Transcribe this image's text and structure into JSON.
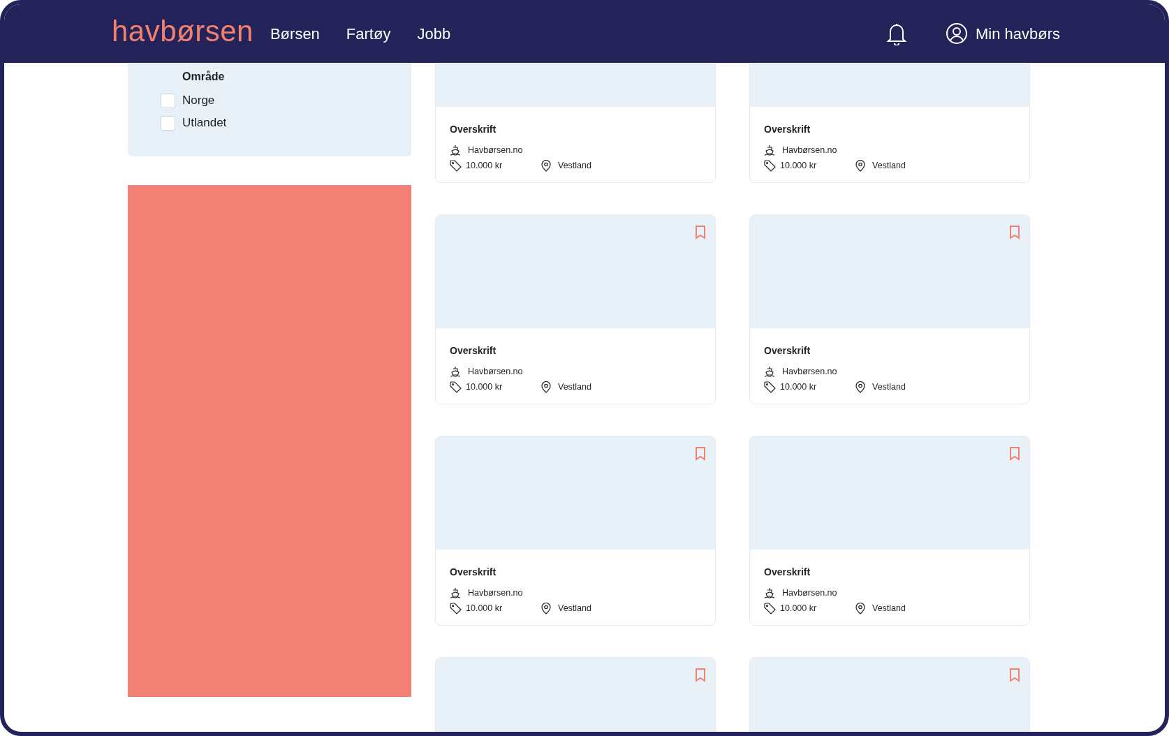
{
  "header": {
    "logo": "havbørsen",
    "nav": [
      {
        "label": "Børsen"
      },
      {
        "label": "Fartøy"
      },
      {
        "label": "Jobb"
      }
    ],
    "account": "Min havbørs"
  },
  "filter": {
    "title": "Område",
    "options": [
      {
        "label": "Norge",
        "checked": false
      },
      {
        "label": "Utlandet",
        "checked": false
      }
    ]
  },
  "ad": {
    "kind": "banner"
  },
  "cards": [
    {
      "title": "Overskrift",
      "source": "Havbørsen.no",
      "price": "10.000 kr",
      "location": "Vestland"
    },
    {
      "title": "Overskrift",
      "source": "Havbørsen.no",
      "price": "10.000 kr",
      "location": "Vestland"
    },
    {
      "bookmarked": false,
      "title": "Overskrift",
      "source": "Havbørsen.no",
      "price": "10.000 kr",
      "location": "Vestland"
    },
    {
      "bookmarked": false,
      "title": "Overskrift",
      "source": "Havbørsen.no",
      "price": "10.000 kr",
      "location": "Vestland"
    },
    {
      "bookmarked": false,
      "title": "Overskrift",
      "source": "Havbørsen.no",
      "price": "10.000 kr",
      "location": "Vestland"
    },
    {
      "bookmarked": false,
      "title": "Overskrift",
      "source": "Havbørsen.no",
      "price": "10.000 kr",
      "location": "Vestland"
    },
    {
      "bookmarked": false
    },
    {
      "bookmarked": false
    }
  ]
}
